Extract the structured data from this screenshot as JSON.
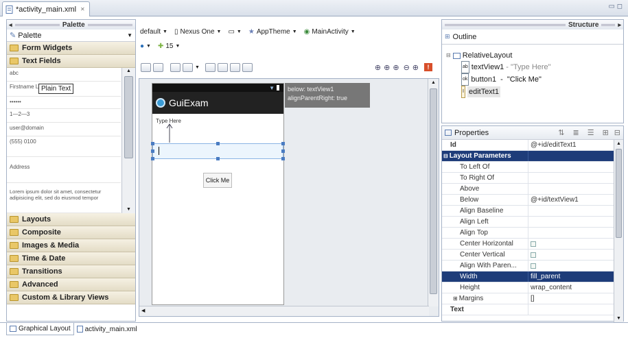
{
  "editor_tab": {
    "title": "*activity_main.xml",
    "close": "✕"
  },
  "palette": {
    "header": "Palette",
    "dropdown": "Palette",
    "categories_top": [
      "Form Widgets",
      "Text Fields"
    ],
    "items": [
      "abc",
      "Firstname Lastname",
      "••••••",
      "1—2—3",
      "user@domain",
      "(555) 0100",
      "Address",
      "Lorem ipsum dolor sit amet, consectetur adipisicing elit, sed do eiusmod tempor"
    ],
    "tooltip": "Plain Text",
    "categories_bottom": [
      "Layouts",
      "Composite",
      "Images & Media",
      "Time & Date",
      "Transitions",
      "Advanced",
      "Custom & Library Views"
    ]
  },
  "toolbar": {
    "config": "default",
    "device": "Nexus One",
    "theme": "AppTheme",
    "activity": "MainActivity",
    "api": "15"
  },
  "device_screen": {
    "app_title": "GuiExam",
    "text_label": "Type Here",
    "button_label": "Click Me"
  },
  "hint_box": [
    "below: textView1",
    "alignParentRight: true"
  ],
  "bottom_tabs": [
    "Graphical Layout",
    "activity_main.xml"
  ],
  "structure": {
    "header": "Structure",
    "outline_label": "Outline",
    "root": "RelativeLayout",
    "children": [
      {
        "id": "textView1",
        "suffix": " - \"Type Here\""
      },
      {
        "id": "button1",
        "suffix": " - \"Click Me\""
      },
      {
        "id": "editText1",
        "suffix": ""
      }
    ]
  },
  "properties": {
    "header": "Properties",
    "id_key": "Id",
    "id_value": "@+id/editText1",
    "section": "Layout Parameters",
    "rows": [
      {
        "key": "To Left Of",
        "value": "",
        "check": false
      },
      {
        "key": "To Right Of",
        "value": "",
        "check": false
      },
      {
        "key": "Above",
        "value": "",
        "check": false
      },
      {
        "key": "Below",
        "value": "@+id/textView1",
        "check": false
      },
      {
        "key": "Align Baseline",
        "value": "",
        "check": false
      },
      {
        "key": "Align Left",
        "value": "",
        "check": false
      },
      {
        "key": "Align Top",
        "value": "",
        "check": false
      },
      {
        "key": "Center Horizontal",
        "value": "",
        "check": true
      },
      {
        "key": "Center Vertical",
        "value": "",
        "check": true
      },
      {
        "key": "Align With Paren...",
        "value": "",
        "check": true
      }
    ],
    "width_key": "Width",
    "width_value": "fill_parent",
    "height_key": "Height",
    "height_value": "wrap_content",
    "margins_key": "Margins",
    "text_key": "Text"
  }
}
